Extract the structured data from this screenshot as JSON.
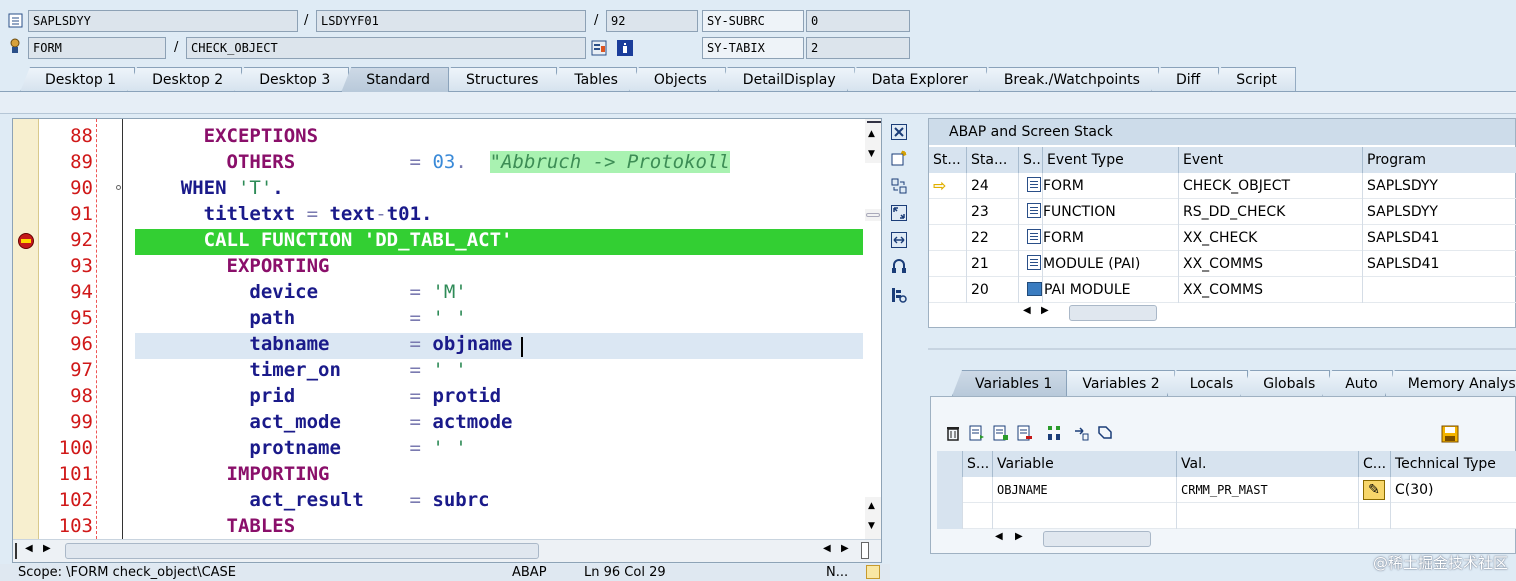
{
  "header": {
    "program": "SAPLSDYY",
    "include": "LSDYYF01",
    "line": "92",
    "subrc_label": "SY-SUBRC",
    "subrc_value": "0",
    "event_type": "FORM",
    "event_name": "CHECK_OBJECT",
    "tabix_label": "SY-TABIX",
    "tabix_value": "2"
  },
  "tabs": [
    "Desktop 1",
    "Desktop 2",
    "Desktop 3",
    "Standard",
    "Structures",
    "Tables",
    "Objects",
    "DetailDisplay",
    "Data Explorer",
    "Break./Watchpoints",
    "Diff",
    "Script"
  ],
  "active_tab": "Standard",
  "editor": {
    "lines": [
      {
        "n": "88",
        "parts": [
          [
            "kw",
            "      EXCEPTIONS"
          ]
        ]
      },
      {
        "n": "89",
        "parts": [
          [
            "kw",
            "        OTHERS"
          ],
          [
            "op",
            "          = "
          ],
          [
            "num",
            "03"
          ],
          [
            "op",
            ".  "
          ],
          [
            "cmt",
            "\"Abbruch -> Protokoll"
          ]
        ]
      },
      {
        "n": "90",
        "parts": [
          [
            "id",
            "    WHEN "
          ],
          [
            "str",
            "'T'"
          ],
          [
            "id",
            "."
          ]
        ]
      },
      {
        "n": "91",
        "parts": [
          [
            "id",
            "      titletxt "
          ],
          [
            "op",
            "= "
          ],
          [
            "id",
            "text"
          ],
          [
            "op",
            "-"
          ],
          [
            "id",
            "t01."
          ]
        ]
      },
      {
        "n": "92",
        "parts": [
          [
            "plain",
            "      CALL FUNCTION 'DD_TABL_ACT'"
          ]
        ]
      },
      {
        "n": "93",
        "parts": [
          [
            "kw",
            "        EXPORTING"
          ]
        ]
      },
      {
        "n": "94",
        "parts": [
          [
            "id",
            "          device"
          ],
          [
            "op",
            "        = "
          ],
          [
            "str",
            "'M'"
          ]
        ]
      },
      {
        "n": "95",
        "parts": [
          [
            "id",
            "          path"
          ],
          [
            "op",
            "          = "
          ],
          [
            "str",
            "' '"
          ]
        ]
      },
      {
        "n": "96",
        "parts": [
          [
            "id",
            "          tabname"
          ],
          [
            "op",
            "       = "
          ],
          [
            "id",
            "objname"
          ]
        ]
      },
      {
        "n": "97",
        "parts": [
          [
            "id",
            "          timer_on"
          ],
          [
            "op",
            "      = "
          ],
          [
            "str",
            "' '"
          ]
        ]
      },
      {
        "n": "98",
        "parts": [
          [
            "id",
            "          prid"
          ],
          [
            "op",
            "          = "
          ],
          [
            "id",
            "protid"
          ]
        ]
      },
      {
        "n": "99",
        "parts": [
          [
            "id",
            "          act_mode"
          ],
          [
            "op",
            "      = "
          ],
          [
            "id",
            "actmode"
          ]
        ]
      },
      {
        "n": "100",
        "parts": [
          [
            "id",
            "          protname"
          ],
          [
            "op",
            "      = "
          ],
          [
            "str",
            "' '"
          ]
        ]
      },
      {
        "n": "101",
        "parts": [
          [
            "kw",
            "        IMPORTING"
          ]
        ]
      },
      {
        "n": "102",
        "parts": [
          [
            "id",
            "          act_result"
          ],
          [
            "op",
            "    = "
          ],
          [
            "id",
            "subrc"
          ]
        ]
      },
      {
        "n": "103",
        "parts": [
          [
            "kw",
            "        TABLES"
          ]
        ]
      }
    ],
    "current_line": "92",
    "cursor_line": "96"
  },
  "status": {
    "scope": "Scope: \\FORM check_object\\CASE",
    "lang": "ABAP",
    "position": "Ln  96 Col  29",
    "mode": "N..."
  },
  "stack": {
    "title": "ABAP and Screen Stack",
    "columns": [
      "St...",
      "Sta...",
      "S..",
      "Event Type",
      "Event",
      "Program"
    ],
    "rows": [
      {
        "status": "⇨",
        "level": "24",
        "type": "FORM",
        "event": "CHECK_OBJECT",
        "program": "SAPLSDYY",
        "icon": "doc"
      },
      {
        "status": "",
        "level": "23",
        "type": "FUNCTION",
        "event": "RS_DD_CHECK",
        "program": "SAPLSDYY",
        "icon": "doc"
      },
      {
        "status": "",
        "level": "22",
        "type": "FORM",
        "event": "XX_CHECK",
        "program": "SAPLSD41",
        "icon": "doc"
      },
      {
        "status": "",
        "level": "21",
        "type": "MODULE (PAI)",
        "event": "XX_COMMS",
        "program": "SAPLSD41",
        "icon": "doc"
      },
      {
        "status": "",
        "level": "20",
        "type": "PAI MODULE",
        "event": "XX_COMMS",
        "program": "",
        "icon": "pic"
      }
    ]
  },
  "var_tabs": [
    "Variables 1",
    "Variables 2",
    "Locals",
    "Globals",
    "Auto",
    "Memory Analysis"
  ],
  "variables": {
    "columns": [
      "S...",
      "Variable",
      "Val.",
      "C...",
      "Technical Type"
    ],
    "rows": [
      {
        "variable": "OBJNAME",
        "value": "CRMM_PR_MAST",
        "type": "C(30)"
      },
      {
        "variable": "",
        "value": "",
        "type": ""
      }
    ]
  },
  "watermark": "@稀土掘金技术社区"
}
